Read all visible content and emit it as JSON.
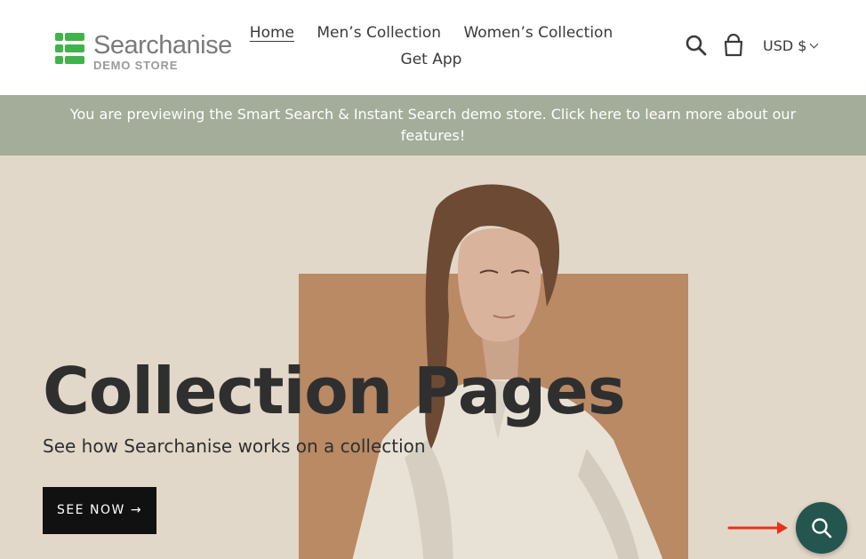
{
  "header": {
    "logo": {
      "text": "Searchanise",
      "sub": "DEMO STORE"
    },
    "nav": [
      {
        "label": "Home",
        "active": true
      },
      {
        "label": "Men’s Collection"
      },
      {
        "label": "Women’s Collection"
      },
      {
        "label": "Get App"
      }
    ],
    "search_icon": "search-icon",
    "cart_icon": "cart-icon",
    "currency": "USD $"
  },
  "announcement": "You are previewing the Smart Search & Instant Search demo store. Click here to learn more about our features!",
  "hero": {
    "title": "Collection Pages",
    "subtitle": "See how Searchanise works on a collection",
    "cta_label": "SEE NOW",
    "cta_arrow": "→"
  },
  "colors": {
    "announce_bg": "#a3ad9a",
    "hero_bg": "#e2d8c9",
    "accent_tan": "#b98a64",
    "fab_bg": "#24564f",
    "red_arrow": "#e8321c",
    "logo_green": "#3fb44a"
  },
  "floating": {
    "icon": "search-icon",
    "pointer_icon": "arrow-right-icon"
  }
}
